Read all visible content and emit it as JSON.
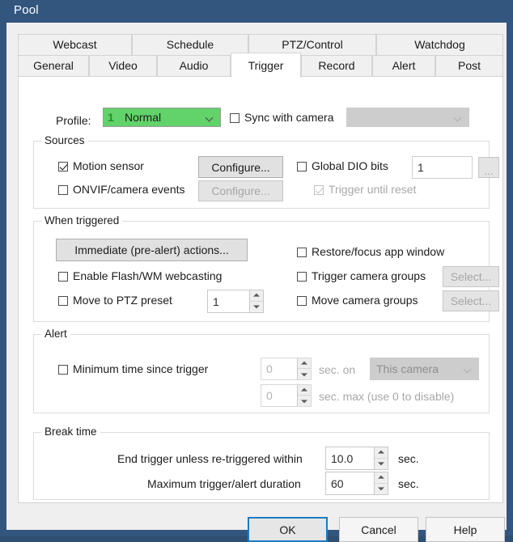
{
  "window": {
    "title": "Pool",
    "titlebar_color": "#33567f",
    "client_bg": "#efefef"
  },
  "tabs": {
    "top_row": [
      {
        "label": "Webcast",
        "selected": false
      },
      {
        "label": "Schedule",
        "selected": false
      },
      {
        "label": "PTZ/Control",
        "selected": false
      },
      {
        "label": "Watchdog",
        "selected": false
      }
    ],
    "bottom_row": [
      {
        "label": "General",
        "selected": false
      },
      {
        "label": "Video",
        "selected": false
      },
      {
        "label": "Audio",
        "selected": false
      },
      {
        "label": "Trigger",
        "selected": true
      },
      {
        "label": "Record",
        "selected": false
      },
      {
        "label": "Alert",
        "selected": false
      },
      {
        "label": "Post",
        "selected": false
      }
    ]
  },
  "profile": {
    "label": "Profile:",
    "value": "Normal",
    "index": "1",
    "accent_color": "#62d26a",
    "sync_with_camera": {
      "label": "Sync with camera",
      "checked": false
    },
    "sync_camera_select": {
      "value": "",
      "enabled": false
    }
  },
  "sources": {
    "title": "Sources",
    "motion_sensor": {
      "label": "Motion sensor",
      "checked": true
    },
    "motion_configure": {
      "label": "Configure...",
      "enabled": true
    },
    "onvif_events": {
      "label": "ONVIF/camera events",
      "checked": false
    },
    "onvif_configure": {
      "label": "Configure...",
      "enabled": false
    },
    "global_dio": {
      "label": "Global DIO bits",
      "checked": false
    },
    "global_dio_value": "1",
    "global_dio_browse": {
      "label": "...",
      "enabled": false
    },
    "trigger_until_reset": {
      "label": "Trigger until reset",
      "checked": true,
      "enabled": false
    }
  },
  "when_triggered": {
    "title": "When triggered",
    "immediate_actions": {
      "label": "Immediate (pre-alert) actions...",
      "enabled": true
    },
    "enable_flash_wm": {
      "label": "Enable Flash/WM webcasting",
      "checked": false
    },
    "move_to_ptz_preset": {
      "label": "Move to PTZ preset",
      "checked": false
    },
    "ptz_preset_value": "1",
    "restore_focus_window": {
      "label": "Restore/focus app window",
      "checked": false
    },
    "trigger_camera_groups": {
      "label": "Trigger camera groups",
      "checked": false
    },
    "trigger_groups_select": {
      "label": "Select...",
      "enabled": false
    },
    "move_camera_groups": {
      "label": "Move camera groups",
      "checked": false
    },
    "move_groups_select": {
      "label": "Select...",
      "enabled": false
    }
  },
  "alert": {
    "title": "Alert",
    "minimum_time": {
      "label": "Minimum time since trigger",
      "checked": false
    },
    "min_time_value": "0",
    "sec_on_label": "sec. on",
    "camera_scope": {
      "value": "This camera",
      "enabled": false
    },
    "max_time_value": "0",
    "sec_max_label": "sec. max (use 0 to disable)"
  },
  "break_time": {
    "title": "Break time",
    "end_trigger_label": "End trigger unless re-triggered within",
    "end_trigger_value": "10.0",
    "end_trigger_unit": "sec.",
    "max_duration_label": "Maximum trigger/alert duration",
    "max_duration_value": "60",
    "max_duration_unit": "sec."
  },
  "buttons": {
    "ok": "OK",
    "cancel": "Cancel",
    "help": "Help"
  }
}
